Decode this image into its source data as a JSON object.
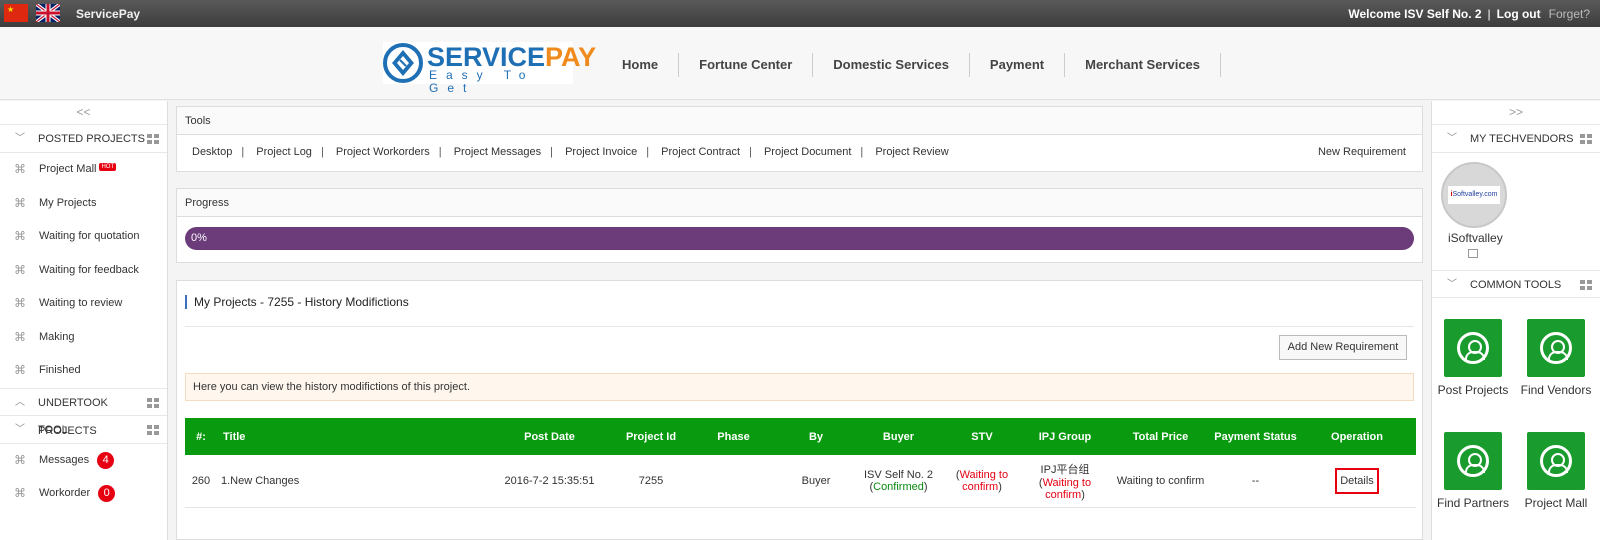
{
  "topbar": {
    "brand": "ServicePay",
    "welcome": "Welcome ISV Self No. 2",
    "sep": "|",
    "logout": "Log out",
    "forget": "Forget?"
  },
  "logo": {
    "name_a": "SERVICE",
    "name_b": "PAY",
    "tagline": "Easy To Get"
  },
  "nav": [
    "Home",
    "Fortune Center",
    "Domestic Services",
    "Payment",
    "Merchant Services"
  ],
  "left": {
    "collapse": "<<",
    "posted_title": "POSTED PROJECTS",
    "posted_items": [
      "Project Mall",
      "My Projects",
      "Waiting for quotation",
      "Waiting for feedback",
      "Waiting to review",
      "Making",
      "Finished"
    ],
    "hot_label": "HOT",
    "undertook_title": "UNDERTOOK PROJECTS",
    "tool_title": "TOOL",
    "tool_items": [
      {
        "label": "Messages",
        "count": "4"
      },
      {
        "label": "Workorder",
        "count": "0"
      }
    ]
  },
  "right": {
    "collapse": ">>",
    "vendors_title": "MY TECHVENDORS",
    "vendor_logo_a": "i",
    "vendor_logo_b": "Softvalley.com",
    "vendor_name": "iSoftvalley",
    "tools_title": "COMMON TOOLS",
    "tools": [
      "Post Projects",
      "Find Vendors",
      "Find Partners",
      "Project Mall"
    ]
  },
  "tools_panel": {
    "title": "Tools",
    "tabs": [
      "Desktop",
      "Project Log",
      "Project Workorders",
      "Project Messages",
      "Project Invoice",
      "Project Contract",
      "Project Document",
      "Project Review"
    ],
    "tab_sep": "|",
    "new_requirement": "New Requirement"
  },
  "progress_panel": {
    "title": "Progress",
    "label": "0%",
    "value": 0
  },
  "history": {
    "title": "My Projects - 7255 - History Modifictions",
    "add_button": "Add New Requirement",
    "notice": "Here you can view the history modifictions of this project.",
    "columns": [
      "#:",
      "Title",
      "Post Date",
      "Project Id",
      "Phase",
      "By",
      "Buyer",
      "STV",
      "IPJ Group",
      "Total Price",
      "Payment Status",
      "Operation"
    ],
    "rows": [
      {
        "num": "260",
        "title": "1.New Changes",
        "post_date": "2016-7-2 15:35:51",
        "project_id": "7255",
        "phase": "",
        "by": "Buyer",
        "buyer_name": "ISV Self No. 2",
        "buyer_status": "Confirmed",
        "stv_status": "Waiting to confirm",
        "ipj_name": "IPJ平台组",
        "ipj_status": "Waiting to confirm",
        "total_price": "Waiting to confirm",
        "payment_status": "--",
        "operation": "Details"
      }
    ]
  },
  "colors": {
    "accent_green": "#0a9a10",
    "progress_purple": "#6b3b7a",
    "alert_red": "#e60012",
    "brand_blue": "#1f6fb5",
    "brand_orange": "#f08a1c"
  }
}
